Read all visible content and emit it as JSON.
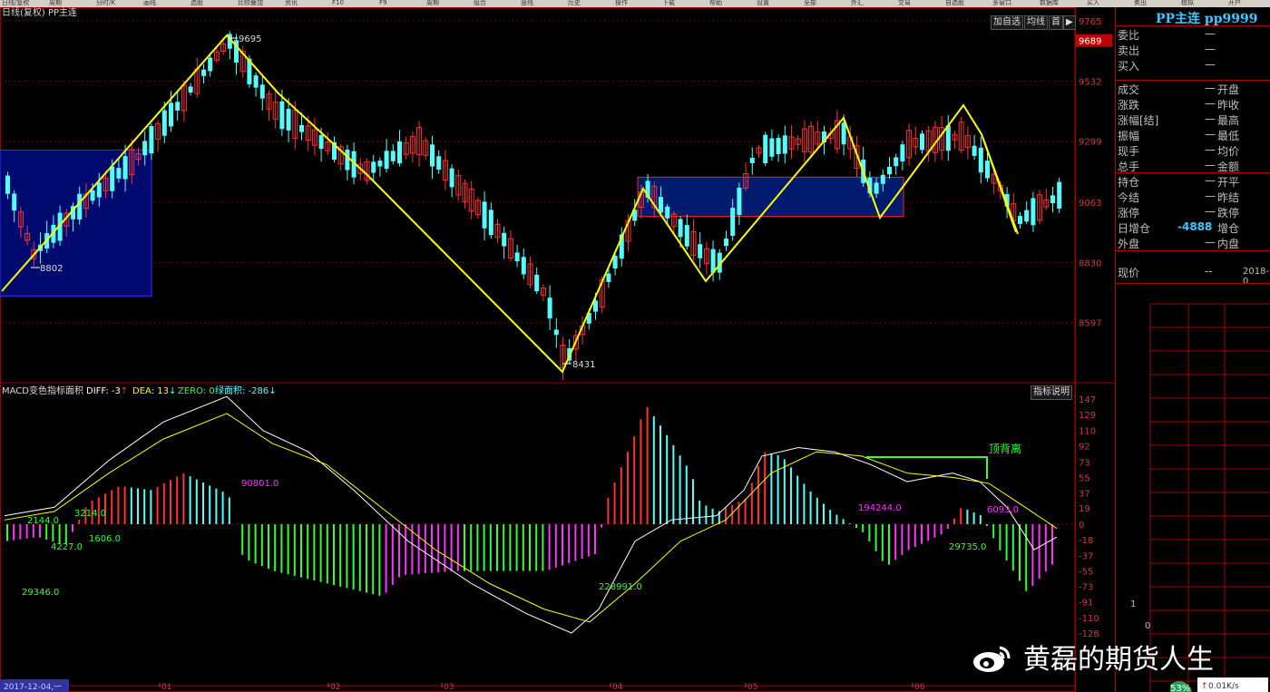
{
  "toolbar": {
    "items": [
      "日线/复权",
      "周期",
      "分时/K",
      "画线",
      "选股",
      "比较叠加",
      "资讯",
      "F10",
      "F9",
      "周期",
      "组合",
      "竖线",
      "历史",
      "操作",
      "下载",
      "帮助",
      "设置",
      "全部",
      "外汇",
      "交易",
      "自选股",
      "多窗口",
      "数据库",
      "买入",
      "卖出",
      "模拟",
      "开户"
    ]
  },
  "chart": {
    "header_left": "日线(复权)  PP主连",
    "buttons": [
      "加自选",
      "均线",
      "首"
    ],
    "price_axis": [
      "9765",
      "9689",
      "9532",
      "9299",
      "9063",
      "8830",
      "8597"
    ],
    "current_price_tag": "9689",
    "peak_label": "9695",
    "low_label_1": "8802",
    "low_label_2": "8431",
    "x_axis_labels": [
      "2017-12-04,一",
      "01",
      "02",
      "03",
      "04",
      "05",
      "06"
    ]
  },
  "macd": {
    "title": "MACD变色指标面积",
    "diff_label": "DIFF: -3",
    "dea_label": "DEA: 13",
    "zero_label": "ZERO: 0",
    "area_label": "绿面积: -286",
    "explain_button": "指标说明",
    "axis": [
      "147",
      "129",
      "110",
      "92",
      "73",
      "55",
      "37",
      "19",
      "0",
      "-18",
      "-37",
      "-55",
      "-73",
      "-91",
      "-110",
      "-128"
    ],
    "annotations": {
      "a1": "90801.0",
      "a2": "4227.0",
      "a3": "1606.0",
      "a4": "29346.0",
      "a5": "228991.0",
      "a6": "194244.0",
      "a7": "6093.0",
      "a8": "29735.0",
      "a9": "顶背离",
      "a10": "3214.0",
      "a11": "2144.0"
    }
  },
  "side": {
    "title": "PP主连 pp9999",
    "rows_top": [
      {
        "k": "委比",
        "v": "—"
      },
      {
        "k": "卖出",
        "v": "—"
      },
      {
        "k": "买入",
        "v": "—"
      }
    ],
    "rows_mid": [
      {
        "k": "成交",
        "v": "—",
        "k2": "开盘"
      },
      {
        "k": "涨跌",
        "v": "—",
        "k2": "昨收"
      },
      {
        "k": "涨幅[结]",
        "v": "—",
        "k2": "最高"
      },
      {
        "k": "振幅",
        "v": "—",
        "k2": "最低"
      },
      {
        "k": "现手",
        "v": "—",
        "k2": "均价"
      },
      {
        "k": "总手",
        "v": "—",
        "k2": "金额"
      }
    ],
    "rows_bot": [
      {
        "k": "持仓",
        "v": "—",
        "k2": "开平"
      },
      {
        "k": "今结",
        "v": "—",
        "k2": "昨结"
      },
      {
        "k": "涨停",
        "v": "—",
        "k2": "跌停"
      },
      {
        "k": "日增仓",
        "v": "-4888",
        "k2": "增仓"
      },
      {
        "k": "外盘",
        "v": "—",
        "k2": "内盘"
      }
    ],
    "price_row": {
      "k": "现价",
      "v": "--",
      "date": "2018-0"
    },
    "tick_labels": [
      "1",
      "0"
    ]
  },
  "watermark": "黄磊的期货人生",
  "status": {
    "percent": "53%",
    "speed": "0.01K/s"
  },
  "colors": {
    "up": "#ff3232",
    "down": "#54ffff",
    "yellow": "#ffff00",
    "green": "#33ff33",
    "magenta": "#ff33ff",
    "box": "#000080",
    "grid": "#a00000"
  }
}
